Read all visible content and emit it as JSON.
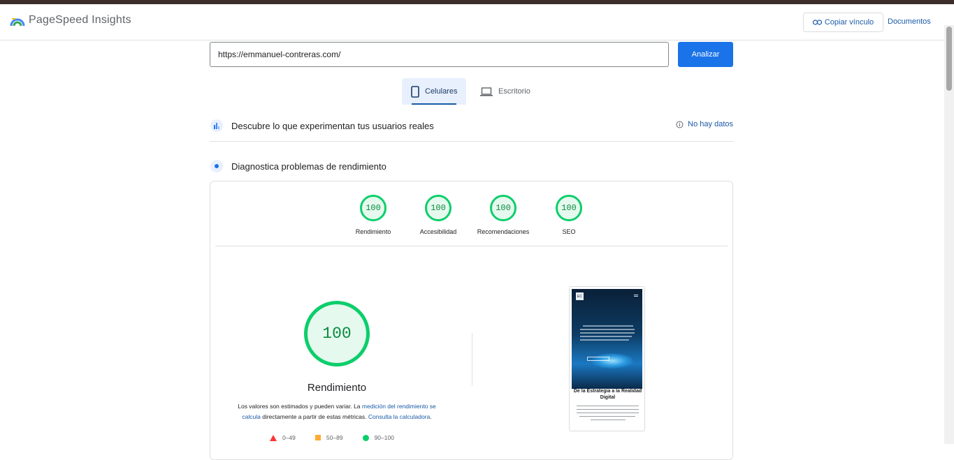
{
  "app": {
    "title": "PageSpeed Insights"
  },
  "header": {
    "copy_link_label": "Copiar vínculo",
    "docs_label": "Documentos"
  },
  "search": {
    "url_value": "https://emmanuel-contreras.com/",
    "analyze_label": "Analizar"
  },
  "tabs": [
    {
      "label": "Celulares",
      "icon": "smartphone-icon",
      "selected": true
    },
    {
      "label": "Escritorio",
      "icon": "laptop-icon",
      "selected": false
    }
  ],
  "field_data": {
    "title": "Descubre lo que experimentan tus usuarios reales",
    "status": "No hay datos"
  },
  "lab_data": {
    "title": "Diagnostica problemas de rendimiento"
  },
  "categories": [
    {
      "label": "Rendimiento",
      "score": "100"
    },
    {
      "label": "Accesibilidad",
      "score": "100"
    },
    {
      "label": "Recomendaciones",
      "score": "100"
    },
    {
      "label": "SEO",
      "score": "100"
    }
  ],
  "performance": {
    "score": "100",
    "label": "Rendimiento",
    "note_prefix": "Los valores son estimados y pueden variar. La ",
    "note_link1": "medición del rendimiento se calcula",
    "note_middle": " directamente a partir de estas métricas. ",
    "note_link2": "Consulta la calculadora",
    "note_suffix": "."
  },
  "legend": [
    {
      "range": "0–49",
      "shape": "triangle",
      "color": "#ff3333"
    },
    {
      "range": "50–89",
      "shape": "square",
      "color": "#ffaa33"
    },
    {
      "range": "90–100",
      "shape": "circle",
      "color": "#0cce6b"
    }
  ],
  "screenshot": {
    "heading": "De la Estrategia a la Realidad Digital",
    "logo_text": "EC"
  },
  "colors": {
    "accent": "#1a73e8",
    "pass": "#0cce6b",
    "link": "#1a5aa8"
  }
}
